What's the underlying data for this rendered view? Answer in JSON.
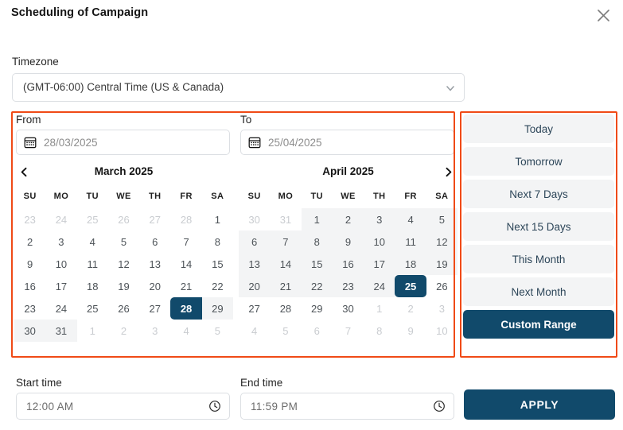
{
  "header": {
    "title": "Scheduling of Campaign",
    "close_icon": "close-icon"
  },
  "timezone": {
    "label": "Timezone",
    "value": "(GMT-06:00) Central Time (US & Canada)",
    "caret_icon": "chevron-down-icon"
  },
  "range": {
    "from": {
      "label": "From",
      "value": "28/03/2025",
      "icon": "calendar-icon"
    },
    "to": {
      "label": "To",
      "value": "25/04/2025",
      "icon": "calendar-icon"
    }
  },
  "calendars": [
    {
      "id": "left",
      "title": "March 2025",
      "prev_icon": "chevron-left-icon",
      "dow": [
        "SU",
        "MO",
        "TU",
        "WE",
        "TH",
        "FR",
        "SA"
      ],
      "weeks": [
        [
          {
            "d": "23",
            "state": "muted"
          },
          {
            "d": "24",
            "state": "muted"
          },
          {
            "d": "25",
            "state": "muted"
          },
          {
            "d": "26",
            "state": "muted"
          },
          {
            "d": "27",
            "state": "muted"
          },
          {
            "d": "28",
            "state": "muted"
          },
          {
            "d": "1",
            "state": "normal"
          }
        ],
        [
          {
            "d": "2",
            "state": "normal"
          },
          {
            "d": "3",
            "state": "normal"
          },
          {
            "d": "4",
            "state": "normal"
          },
          {
            "d": "5",
            "state": "normal"
          },
          {
            "d": "6",
            "state": "normal"
          },
          {
            "d": "7",
            "state": "normal"
          },
          {
            "d": "8",
            "state": "normal"
          }
        ],
        [
          {
            "d": "9",
            "state": "normal"
          },
          {
            "d": "10",
            "state": "normal"
          },
          {
            "d": "11",
            "state": "normal"
          },
          {
            "d": "12",
            "state": "normal"
          },
          {
            "d": "13",
            "state": "normal"
          },
          {
            "d": "14",
            "state": "normal"
          },
          {
            "d": "15",
            "state": "normal"
          }
        ],
        [
          {
            "d": "16",
            "state": "normal"
          },
          {
            "d": "17",
            "state": "normal"
          },
          {
            "d": "18",
            "state": "normal"
          },
          {
            "d": "19",
            "state": "normal"
          },
          {
            "d": "20",
            "state": "normal"
          },
          {
            "d": "21",
            "state": "normal"
          },
          {
            "d": "22",
            "state": "normal"
          }
        ],
        [
          {
            "d": "23",
            "state": "normal"
          },
          {
            "d": "24",
            "state": "normal"
          },
          {
            "d": "25",
            "state": "normal"
          },
          {
            "d": "26",
            "state": "normal"
          },
          {
            "d": "27",
            "state": "normal"
          },
          {
            "d": "28",
            "state": "selected-start"
          },
          {
            "d": "29",
            "state": "inrange"
          }
        ],
        [
          {
            "d": "30",
            "state": "inrange"
          },
          {
            "d": "31",
            "state": "inrange"
          },
          {
            "d": "1",
            "state": "muted"
          },
          {
            "d": "2",
            "state": "muted"
          },
          {
            "d": "3",
            "state": "muted"
          },
          {
            "d": "4",
            "state": "muted"
          },
          {
            "d": "5",
            "state": "muted"
          }
        ]
      ]
    },
    {
      "id": "right",
      "title": "April 2025",
      "next_icon": "chevron-right-icon",
      "dow": [
        "SU",
        "MO",
        "TU",
        "WE",
        "TH",
        "FR",
        "SA"
      ],
      "weeks": [
        [
          {
            "d": "30",
            "state": "muted"
          },
          {
            "d": "31",
            "state": "muted"
          },
          {
            "d": "1",
            "state": "inrange"
          },
          {
            "d": "2",
            "state": "inrange"
          },
          {
            "d": "3",
            "state": "inrange"
          },
          {
            "d": "4",
            "state": "inrange"
          },
          {
            "d": "5",
            "state": "inrange"
          }
        ],
        [
          {
            "d": "6",
            "state": "inrange"
          },
          {
            "d": "7",
            "state": "inrange"
          },
          {
            "d": "8",
            "state": "inrange"
          },
          {
            "d": "9",
            "state": "inrange"
          },
          {
            "d": "10",
            "state": "inrange"
          },
          {
            "d": "11",
            "state": "inrange"
          },
          {
            "d": "12",
            "state": "inrange"
          }
        ],
        [
          {
            "d": "13",
            "state": "inrange"
          },
          {
            "d": "14",
            "state": "inrange"
          },
          {
            "d": "15",
            "state": "inrange"
          },
          {
            "d": "16",
            "state": "inrange"
          },
          {
            "d": "17",
            "state": "inrange"
          },
          {
            "d": "18",
            "state": "inrange"
          },
          {
            "d": "19",
            "state": "inrange"
          }
        ],
        [
          {
            "d": "20",
            "state": "inrange"
          },
          {
            "d": "21",
            "state": "inrange"
          },
          {
            "d": "22",
            "state": "inrange"
          },
          {
            "d": "23",
            "state": "inrange"
          },
          {
            "d": "24",
            "state": "inrange"
          },
          {
            "d": "25",
            "state": "selected-end"
          },
          {
            "d": "26",
            "state": "normal"
          }
        ],
        [
          {
            "d": "27",
            "state": "normal"
          },
          {
            "d": "28",
            "state": "normal"
          },
          {
            "d": "29",
            "state": "normal"
          },
          {
            "d": "30",
            "state": "normal"
          },
          {
            "d": "1",
            "state": "muted"
          },
          {
            "d": "2",
            "state": "muted"
          },
          {
            "d": "3",
            "state": "muted"
          }
        ],
        [
          {
            "d": "4",
            "state": "muted"
          },
          {
            "d": "5",
            "state": "muted"
          },
          {
            "d": "6",
            "state": "muted"
          },
          {
            "d": "7",
            "state": "muted"
          },
          {
            "d": "8",
            "state": "muted"
          },
          {
            "d": "9",
            "state": "muted"
          },
          {
            "d": "10",
            "state": "muted"
          }
        ]
      ]
    }
  ],
  "presets": [
    {
      "label": "Today",
      "active": false
    },
    {
      "label": "Tomorrow",
      "active": false
    },
    {
      "label": "Next 7 Days",
      "active": false
    },
    {
      "label": "Next 15 Days",
      "active": false
    },
    {
      "label": "This Month",
      "active": false
    },
    {
      "label": "Next Month",
      "active": false
    },
    {
      "label": "Custom Range",
      "active": true
    }
  ],
  "times": {
    "start": {
      "label": "Start time",
      "value": "12:00  AM",
      "icon": "clock-icon"
    },
    "end": {
      "label": "End time",
      "value": "11:59  PM",
      "icon": "clock-icon"
    }
  },
  "apply": {
    "label": "APPLY"
  },
  "colors": {
    "accent": "#114A6B",
    "highlight_frame": "#f04a16",
    "inrange_bg": "#f3f4f5",
    "preset_bg": "#f3f4f5",
    "preset_text": "#2d4659",
    "border": "#dcdfe3",
    "muted_text": "#c9ccd0"
  }
}
